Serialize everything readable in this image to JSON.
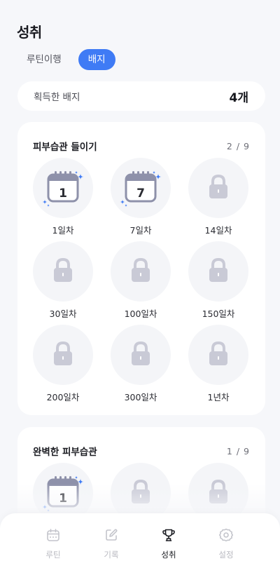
{
  "header": {
    "title": "성취"
  },
  "tabs": [
    {
      "label": "루틴이행",
      "active": false
    },
    {
      "label": "배지",
      "active": true
    }
  ],
  "summary": {
    "label": "획득한 배지",
    "count": "4개"
  },
  "sections": [
    {
      "title": "피부습관 들이기",
      "progress": "2 / 9",
      "badges": [
        {
          "label": "1일차",
          "earned": true,
          "number": "1"
        },
        {
          "label": "7일차",
          "earned": true,
          "number": "7"
        },
        {
          "label": "14일차",
          "earned": false
        },
        {
          "label": "30일차",
          "earned": false
        },
        {
          "label": "100일차",
          "earned": false
        },
        {
          "label": "150일차",
          "earned": false
        },
        {
          "label": "200일차",
          "earned": false
        },
        {
          "label": "300일차",
          "earned": false
        },
        {
          "label": "1년차",
          "earned": false
        }
      ]
    },
    {
      "title": "완벽한 피부습관",
      "progress": "1 / 9",
      "badges": [
        {
          "label": "",
          "earned": true,
          "number": "1"
        },
        {
          "label": "",
          "earned": false
        },
        {
          "label": "",
          "earned": false
        }
      ]
    }
  ],
  "tabbar": [
    {
      "label": "루틴",
      "icon": "calendar-icon",
      "active": false
    },
    {
      "label": "기록",
      "icon": "pencil-icon",
      "active": false
    },
    {
      "label": "성취",
      "icon": "trophy-icon",
      "active": true
    },
    {
      "label": "설정",
      "icon": "gear-icon",
      "active": false
    }
  ],
  "colors": {
    "accent": "#3f7bf5",
    "badge_earned": "#8e91aa",
    "badge_locked": "#c9cad6",
    "sparkle": "#3f7bf5"
  }
}
